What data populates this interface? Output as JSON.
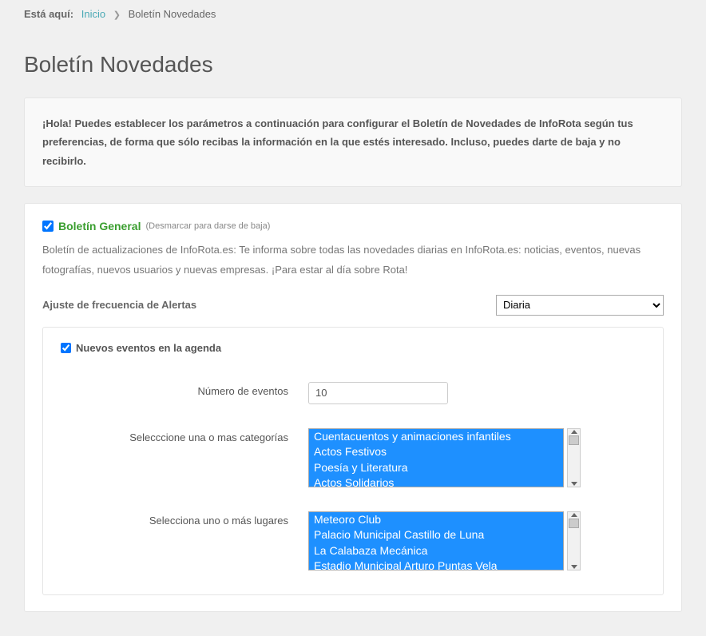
{
  "breadcrumb": {
    "label": "Está aquí:",
    "home": "Inicio",
    "current": "Boletín Novedades"
  },
  "page_title": "Boletín Novedades",
  "intro": "¡Hola! Puedes establecer los parámetros a continuación para configurar el Boletín de Novedades de InfoRota según tus preferencias, de forma que sólo recibas la información en la que estés interesado. Incluso, puedes darte de baja y no recibirlo.",
  "boletin": {
    "title": "Boletín General",
    "hint": "(Desmarcar para darse de baja)",
    "desc": "Boletín de actualizaciones de InfoRota.es: Te informa sobre todas las novedades diarias en InfoRota.es: noticias, eventos, nuevas fotografías, nuevos usuarios y nuevas empresas. ¡Para estar al día sobre Rota!"
  },
  "frequency": {
    "label": "Ajuste de frecuencia de Alertas",
    "selected": "Diaria"
  },
  "eventos": {
    "title": "Nuevos eventos en la agenda",
    "num_label": "Número de eventos",
    "num_value": "10",
    "cat_label": "Selecccione una o mas categorías",
    "categories": [
      "Cuentacuentos y animaciones infantiles",
      "Actos Festivos",
      "Poesía y Literatura",
      "Actos Solidarios"
    ],
    "place_label": "Selecciona uno o más lugares",
    "places": [
      "Meteoro Club",
      "Palacio Municipal Castillo de Luna",
      "La Calabaza Mecánica",
      "Estadio Municipal Arturo Puntas Vela"
    ]
  }
}
